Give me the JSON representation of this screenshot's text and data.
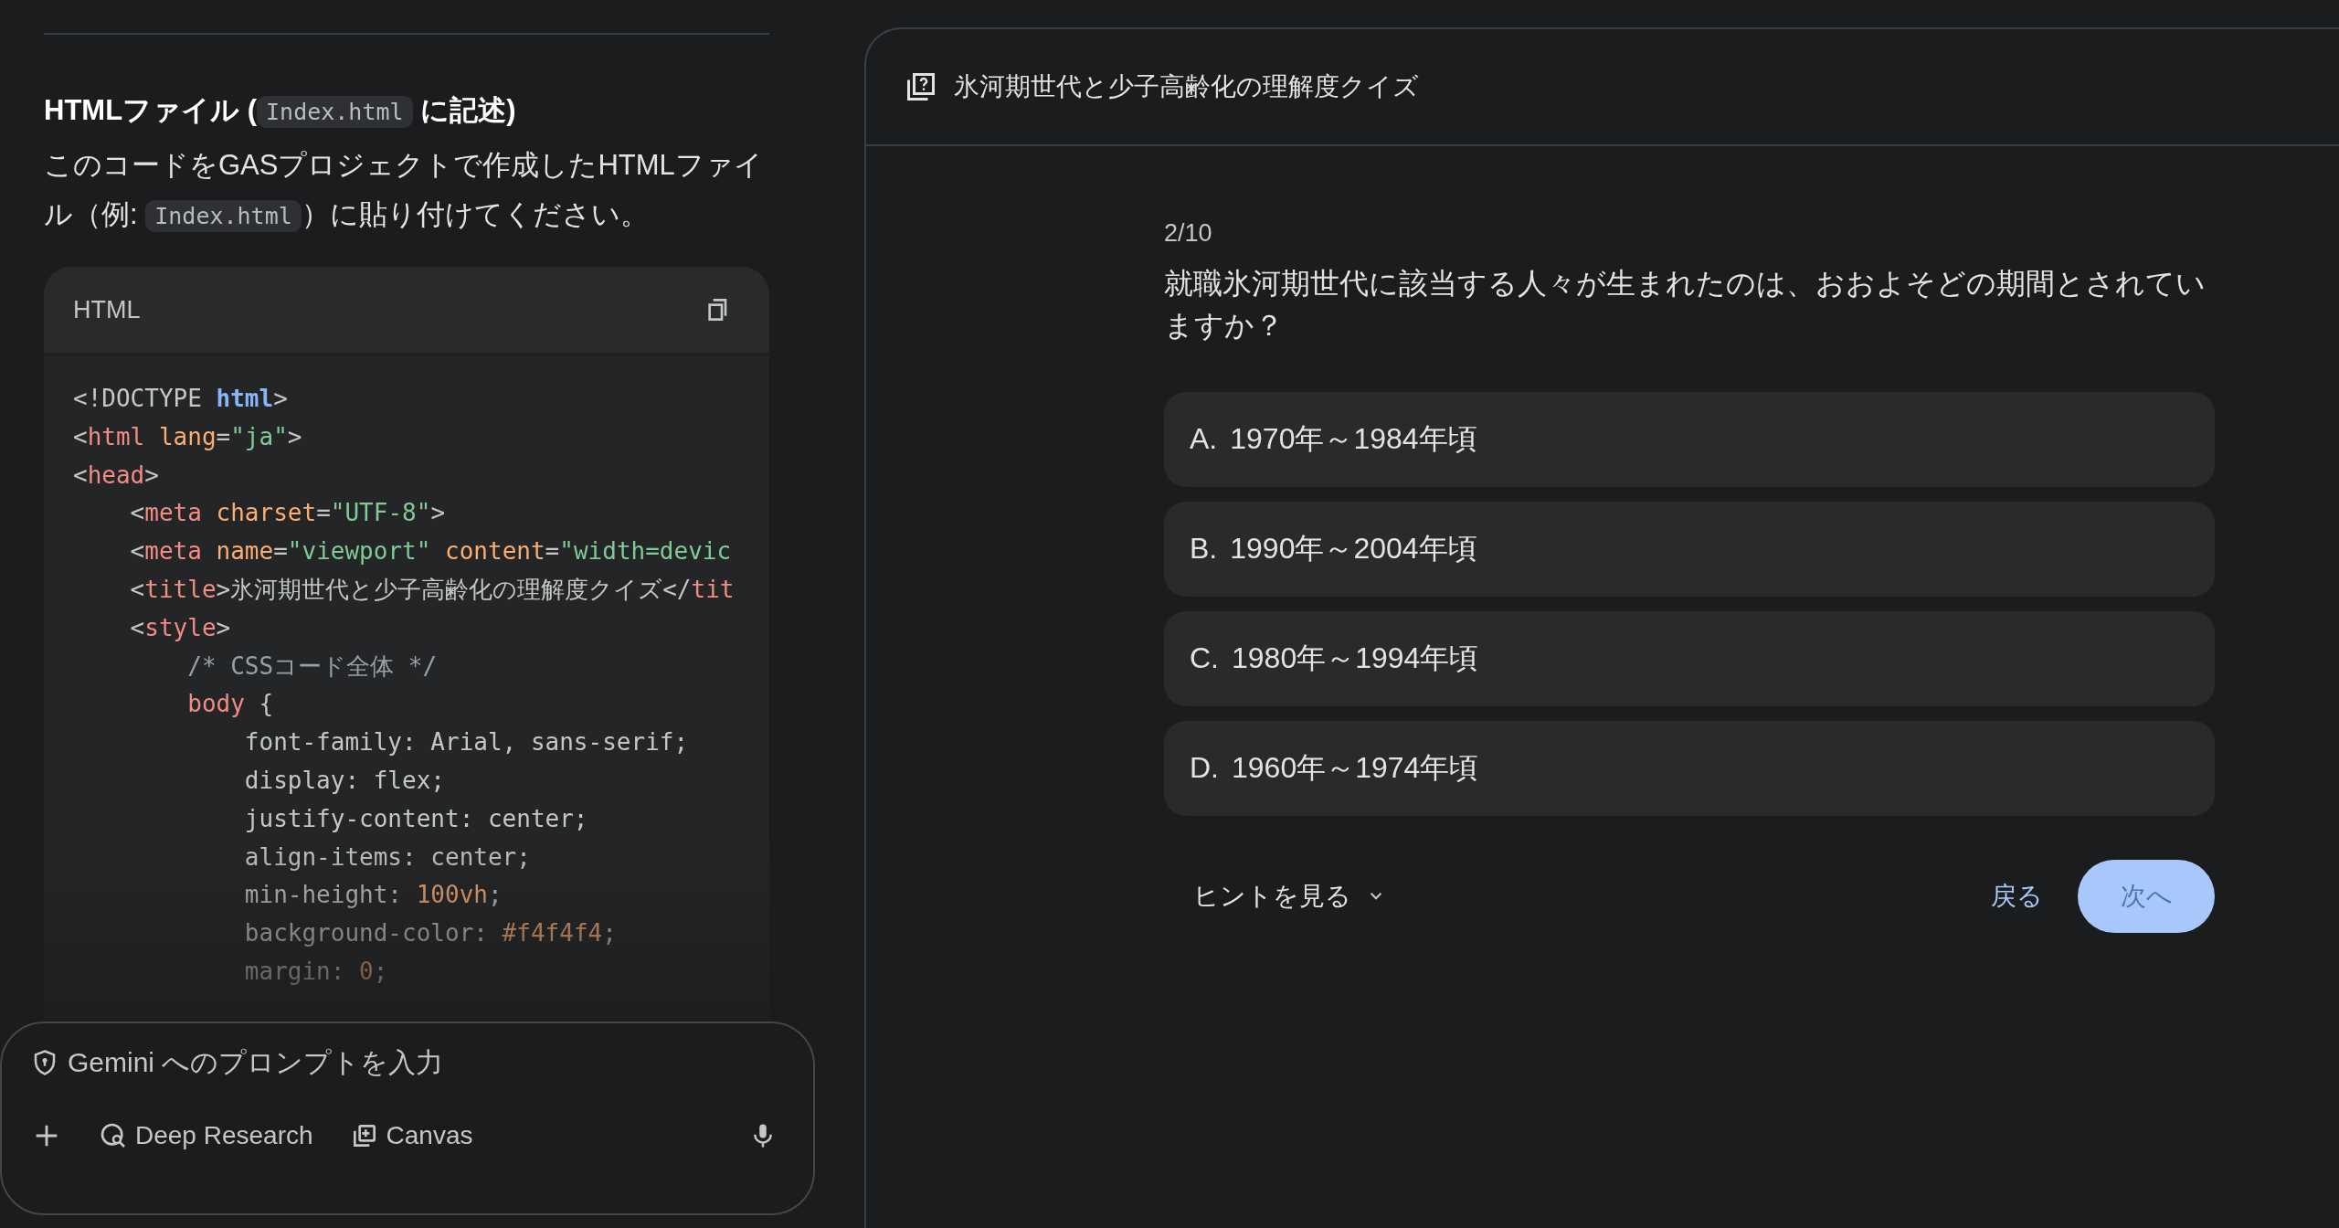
{
  "left_pane": {
    "heading": [
      {
        "kind": "text",
        "text": "HTMLファイル ("
      },
      {
        "kind": "code",
        "text": "Index.html"
      },
      {
        "kind": "text",
        "text": " に記述)"
      }
    ],
    "paragraph": [
      {
        "kind": "text",
        "text": "このコードをGASプロジェクトで作成したHTMLファイル（例: "
      },
      {
        "kind": "code",
        "text": "Index.html"
      },
      {
        "kind": "text",
        "text": "）に貼り付けてください。"
      }
    ],
    "code_block": {
      "language": "HTML",
      "lines": [
        [
          {
            "kind": "punct",
            "text": "<!DOCTYPE "
          },
          {
            "kind": "keyword",
            "text": "html"
          },
          {
            "kind": "punct",
            "text": ">"
          }
        ],
        [
          {
            "kind": "punct",
            "text": "<"
          },
          {
            "kind": "tag",
            "text": "html "
          },
          {
            "kind": "attr",
            "text": "lang"
          },
          {
            "kind": "punct",
            "text": "="
          },
          {
            "kind": "string",
            "text": "\"ja\""
          },
          {
            "kind": "punct",
            "text": ">"
          }
        ],
        [
          {
            "kind": "punct",
            "text": "<"
          },
          {
            "kind": "tag",
            "text": "head"
          },
          {
            "kind": "punct",
            "text": ">"
          }
        ],
        [
          {
            "kind": "punct",
            "text": "    <"
          },
          {
            "kind": "tag",
            "text": "meta "
          },
          {
            "kind": "attr",
            "text": "charset"
          },
          {
            "kind": "punct",
            "text": "="
          },
          {
            "kind": "string",
            "text": "\"UTF-8\""
          },
          {
            "kind": "punct",
            "text": ">"
          }
        ],
        [
          {
            "kind": "punct",
            "text": "    <"
          },
          {
            "kind": "tag",
            "text": "meta "
          },
          {
            "kind": "attr",
            "text": "name"
          },
          {
            "kind": "punct",
            "text": "="
          },
          {
            "kind": "string",
            "text": "\"viewport\" "
          },
          {
            "kind": "attr",
            "text": "content"
          },
          {
            "kind": "punct",
            "text": "="
          },
          {
            "kind": "string",
            "text": "\"width=devic"
          }
        ],
        [
          {
            "kind": "punct",
            "text": "    <"
          },
          {
            "kind": "tag",
            "text": "title"
          },
          {
            "kind": "punct",
            "text": ">氷河期世代と少子高齢化の理解度クイズ</"
          },
          {
            "kind": "tag",
            "text": "tit"
          }
        ],
        [
          {
            "kind": "punct",
            "text": "    <"
          },
          {
            "kind": "tag",
            "text": "style"
          },
          {
            "kind": "punct",
            "text": ">"
          }
        ],
        [
          {
            "kind": "comment",
            "text": "        /* CSSコード全体 */"
          }
        ],
        [
          {
            "kind": "tag",
            "text": "        body "
          },
          {
            "kind": "punct",
            "text": "{"
          }
        ],
        [
          {
            "kind": "prop",
            "text": "            font-family: Arial, sans-serif;"
          }
        ],
        [
          {
            "kind": "prop",
            "text": "            display: flex;"
          }
        ],
        [
          {
            "kind": "prop",
            "text": "            justify-content: center;"
          }
        ],
        [
          {
            "kind": "prop",
            "text": "            align-items: center;"
          }
        ],
        [
          {
            "kind": "prop",
            "text": "            min-height: "
          },
          {
            "kind": "number",
            "text": "100vh"
          },
          {
            "kind": "prop",
            "text": ";"
          }
        ],
        [
          {
            "kind": "prop",
            "text": "            background-color: "
          },
          {
            "kind": "number",
            "text": "#f4f4f4"
          },
          {
            "kind": "prop",
            "text": ";"
          }
        ],
        [
          {
            "kind": "prop",
            "text": "            margin: "
          },
          {
            "kind": "number",
            "text": "0"
          },
          {
            "kind": "prop",
            "text": ";"
          }
        ]
      ]
    }
  },
  "prompt_box": {
    "placeholder": "Gemini へのプロンプトを入力",
    "tools": [
      "Deep Research",
      "Canvas"
    ]
  },
  "quiz_panel": {
    "title": "氷河期世代と少子高齢化の理解度クイズ",
    "progress": "2/10",
    "question": "就職氷河期世代に該当する人々が生まれたのは、おおよそどの期間とされていますか？",
    "options": [
      {
        "letter": "A.",
        "text": "1970年～1984年頃"
      },
      {
        "letter": "B.",
        "text": "1990年～2004年頃"
      },
      {
        "letter": "C.",
        "text": "1980年～1994年頃"
      },
      {
        "letter": "D.",
        "text": "1960年～1974年頃"
      }
    ],
    "hint_button": "ヒントを見る",
    "back_button": "戻る",
    "next_button": "次へ"
  }
}
